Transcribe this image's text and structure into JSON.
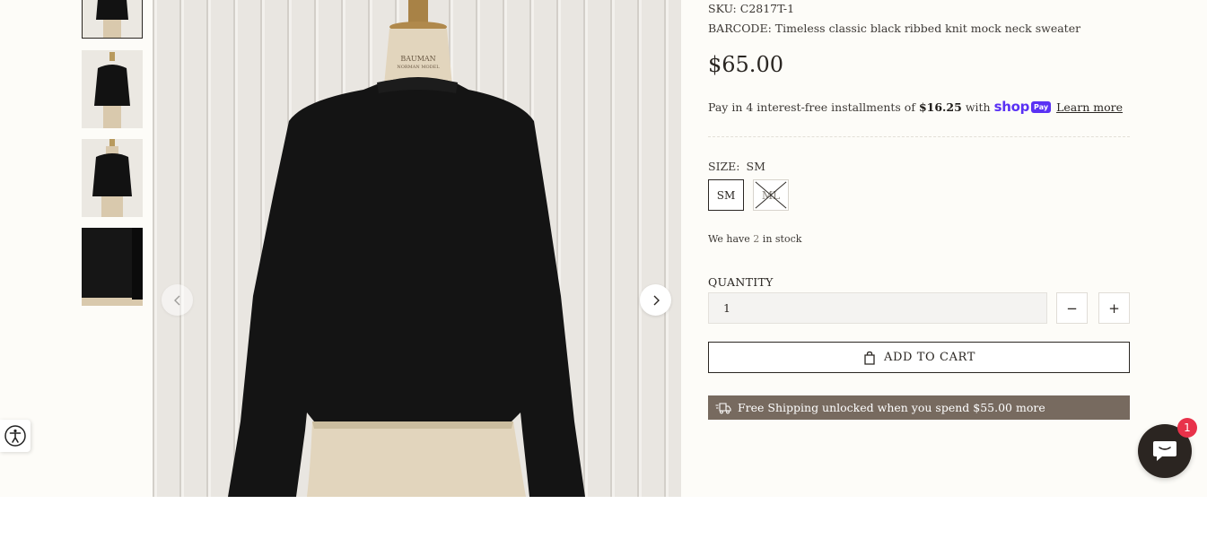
{
  "product": {
    "sku_label": "SKU:",
    "sku": "C2817T-1",
    "barcode_label": "BARCODE:",
    "barcode": "Timeless classic black ribbed knit mock neck sweater",
    "price": "$65.00"
  },
  "installments": {
    "prefix": "Pay in 4 interest-free installments of",
    "amount": "$16.25",
    "with": "with",
    "shop_word": "shop",
    "pay_word": "Pay",
    "learn_more": "Learn more"
  },
  "size": {
    "label": "SIZE:",
    "selected": "SM",
    "options": [
      {
        "label": "SM",
        "available": true
      },
      {
        "label": "ML",
        "available": false
      }
    ]
  },
  "stock": {
    "prefix": "We have",
    "count": "2",
    "suffix": "in stock"
  },
  "quantity": {
    "label": "QUANTITY",
    "value": "1",
    "minus": "−",
    "plus": "+"
  },
  "cart": {
    "button_label": "ADD TO CART"
  },
  "shipping": {
    "message": "Free Shipping unlocked when you spend $55.00 more"
  },
  "gallery": {
    "thumbnail_count": 4,
    "active_index": 0,
    "mannequin_text_1": "BAUMAN",
    "mannequin_text_2": "NORMAN MODEL"
  },
  "chat": {
    "badge": "1"
  },
  "colors": {
    "accent_dark": "#2a2622",
    "shipping_bar": "#776a5f",
    "shop_pay": "#5a31f4",
    "chat_badge": "#e8324a",
    "page_background": "#fdfcf8"
  },
  "icons": [
    "chevron-left-icon",
    "chevron-right-icon",
    "shopping-bag-icon",
    "delivery-truck-icon",
    "accessibility-icon",
    "chat-bubble-icon"
  ]
}
